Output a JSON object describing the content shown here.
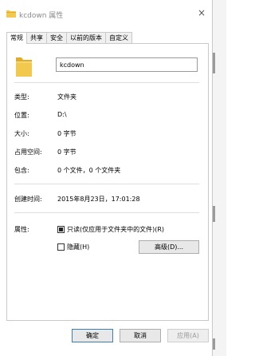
{
  "window": {
    "title": "kcdown 属性",
    "close_glyph": "×"
  },
  "tabs": [
    {
      "label": "常规",
      "active": true
    },
    {
      "label": "共享",
      "active": false
    },
    {
      "label": "安全",
      "active": false
    },
    {
      "label": "以前的版本",
      "active": false
    },
    {
      "label": "自定义",
      "active": false
    }
  ],
  "general": {
    "name": "kcdown",
    "rows": {
      "type": {
        "label": "类型:",
        "value": "文件夹"
      },
      "location": {
        "label": "位置:",
        "value": "D:\\"
      },
      "size": {
        "label": "大小:",
        "value": "0 字节"
      },
      "size_on_disk": {
        "label": "占用空间:",
        "value": "0 字节"
      },
      "contains": {
        "label": "包含:",
        "value": "0 个文件，0 个文件夹"
      },
      "created": {
        "label": "创建时间:",
        "value": "2015年8月23日，17:01:28"
      }
    },
    "attributes": {
      "label": "属性:",
      "readonly": {
        "label": "只读(仅应用于文件夹中的文件)(R)",
        "checked": true
      },
      "hidden": {
        "label": "隐藏(H)",
        "checked": false
      },
      "advanced_button": "高级(D)..."
    }
  },
  "footer": {
    "ok": "确定",
    "cancel": "取消",
    "apply": "应用(A)"
  },
  "colors": {
    "folder_yellow": "#f2c94c",
    "folder_shade": "#e0ad2a",
    "disabled_text": "#9a9a9a"
  },
  "icons": {
    "title_icon": "folder-icon",
    "big_icon": "folder-icon"
  }
}
